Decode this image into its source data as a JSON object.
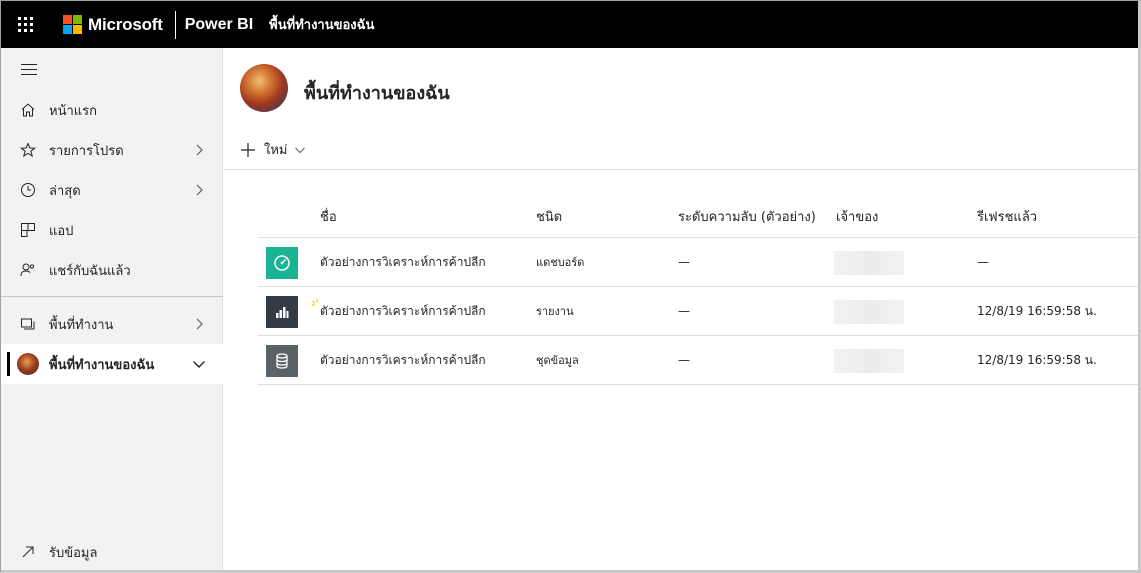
{
  "topbar": {
    "brand": "Microsoft",
    "product": "Power BI",
    "breadcrumb": "พื้นที่ทำงานของฉัน",
    "ms_colors": [
      "#f25022",
      "#7fba00",
      "#00a4ef",
      "#ffb900"
    ]
  },
  "sidebar": {
    "items": [
      {
        "label": "หน้าแรก",
        "icon": "home-icon"
      },
      {
        "label": "รายการโปรด",
        "icon": "star-icon"
      },
      {
        "label": "ล่าสุด",
        "icon": "clock-icon"
      },
      {
        "label": "แอป",
        "icon": "apps-icon"
      },
      {
        "label": "แชร์กับฉันแล้ว",
        "icon": "shared-icon"
      },
      {
        "label": "พื้นที่ทำงาน",
        "icon": "workspaces-icon"
      },
      {
        "label": "พื้นที่ทำงานของฉัน",
        "icon": "avatar"
      }
    ],
    "get_data": "รับข้อมูล"
  },
  "main": {
    "title": "พื้นที่ทำงานของฉัน",
    "new_label": "ใหม่",
    "columns": {
      "name": "ชื่อ",
      "type": "ชนิด",
      "sensitivity": "ระดับความลับ (ตัวอย่าง)",
      "owner": "เจ้าของ",
      "refreshed": "รีเฟรชแล้ว"
    },
    "rows": [
      {
        "name": "ตัวอย่างการวิเคราะห์การค้าปลีก",
        "type": "แดชบอร์ด",
        "sensitivity": "—",
        "refreshed": "—",
        "icon": "dashboard-icon",
        "icon_color": "#1ab394"
      },
      {
        "name": "ตัวอย่างการวิเคราะห์การค้าปลีก",
        "type": "รายงาน",
        "sensitivity": "—",
        "refreshed": "12/8/19 16:59:58 น.",
        "icon": "report-icon",
        "icon_color": "#333c44"
      },
      {
        "name": "ตัวอย่างการวิเคราะห์การค้าปลีก",
        "type": "ชุดข้อมูล",
        "sensitivity": "—",
        "refreshed": "12/8/19 16:59:58 น.",
        "icon": "dataset-icon",
        "icon_color": "#5a6266"
      }
    ]
  }
}
